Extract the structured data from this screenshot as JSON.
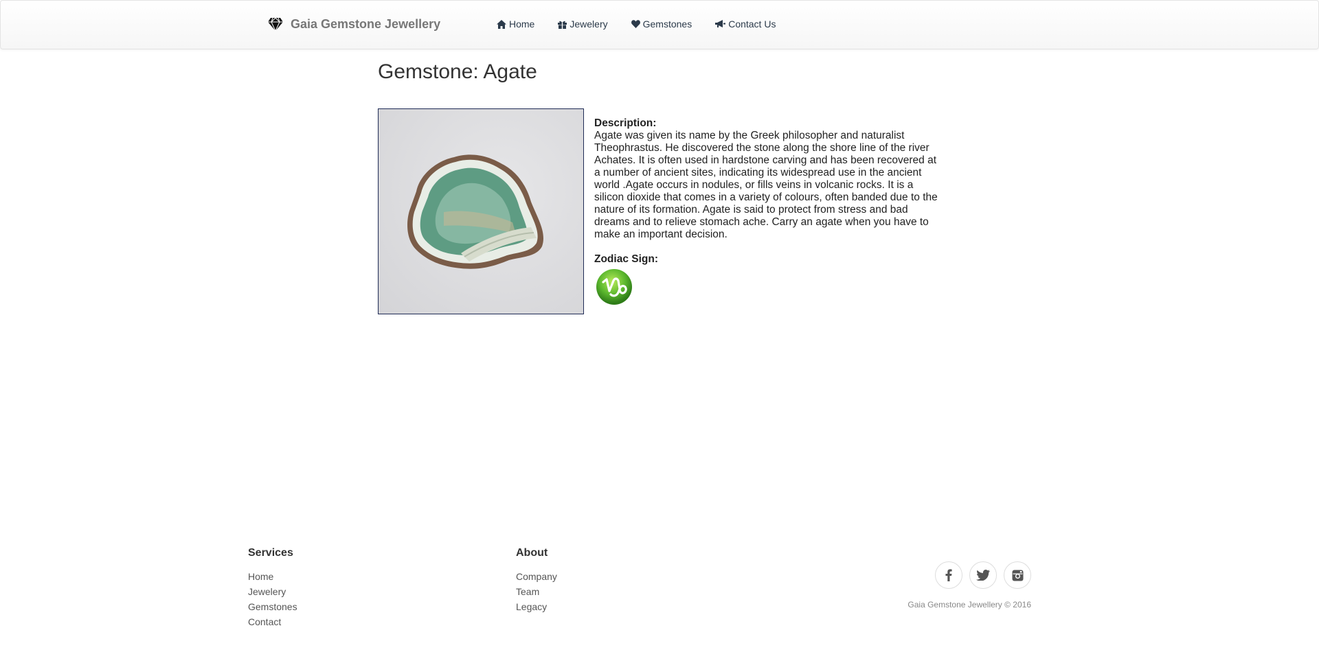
{
  "brand": {
    "name": "Gaia Gemstone Jewellery",
    "icon": "diamond-icon"
  },
  "nav": [
    {
      "label": "Home",
      "icon": "home-icon"
    },
    {
      "label": "Jewelery",
      "icon": "gift-icon"
    },
    {
      "label": "Gemstones",
      "icon": "heart-icon"
    },
    {
      "label": "Contact Us",
      "icon": "bullhorn-icon"
    }
  ],
  "gemstone": {
    "title": "Gemstone: Agate",
    "description_label": "Description:",
    "description": "Agate was given its name by the Greek philosopher and naturalist Theophrastus. He discovered the stone along the shore line of the river Achates. It is often used in hardstone carving and has been recovered at a number of ancient sites, indicating its widespread use in the ancient world .Agate occurs in nodules, or fills veins in volcanic rocks. It is a silicon dioxide that comes in a variety of colours, often banded due to the nature of its formation. Agate is said to protect from stress and bad dreams and to relieve stomach ache. Carry an agate when you have to make an important decision.",
    "zodiac_label": "Zodiac Sign:",
    "zodiac_icon": "capricorn-icon"
  },
  "footer": {
    "services": {
      "heading": "Services",
      "links": [
        "Home",
        "Jewelery",
        "Gemstones",
        "Contact"
      ]
    },
    "about": {
      "heading": "About",
      "links": [
        "Company",
        "Team",
        "Legacy"
      ]
    },
    "social": [
      "facebook-icon",
      "twitter-icon",
      "instagram-icon"
    ],
    "copyright": "Gaia Gemstone Jewellery © 2016"
  },
  "colors": {
    "nav_text": "#2b3a4a",
    "zodiac_green": "#5cb82e",
    "photo_border": "#1e2a55"
  }
}
